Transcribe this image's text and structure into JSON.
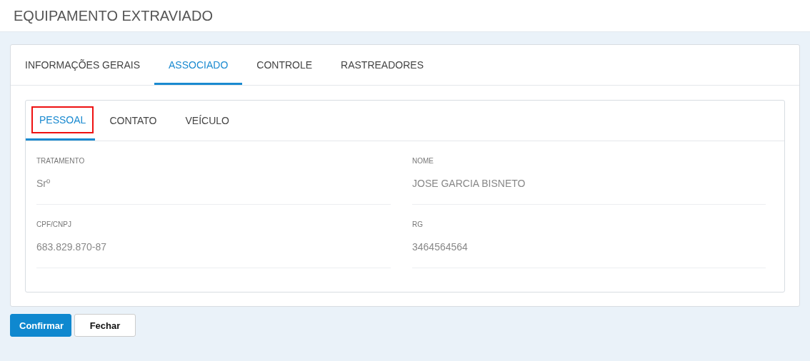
{
  "header": {
    "title": "EQUIPAMENTO EXTRAVIADO"
  },
  "tabs": [
    {
      "label": "INFORMAÇÕES GERAIS",
      "selected": false
    },
    {
      "label": "ASSOCIADO",
      "selected": true
    },
    {
      "label": "CONTROLE",
      "selected": false
    },
    {
      "label": "RASTREADORES",
      "selected": false
    }
  ],
  "subtabs": [
    {
      "label": "PESSOAL",
      "selected": true,
      "highlighted": true
    },
    {
      "label": "CONTATO",
      "selected": false,
      "highlighted": false
    },
    {
      "label": "VEÍCULO",
      "selected": false,
      "highlighted": false
    }
  ],
  "fields": [
    {
      "label": "TRATAMENTO",
      "value": "Srº"
    },
    {
      "label": "NOME",
      "value": "JOSE GARCIA BISNETO"
    },
    {
      "label": "CPF/CNPJ",
      "value": "683.829.870-87"
    },
    {
      "label": "RG",
      "value": "3464564564"
    }
  ],
  "buttons": [
    {
      "label": "Confirmar",
      "kind": "primary"
    },
    {
      "label": "Fechar",
      "kind": "secondary"
    }
  ]
}
